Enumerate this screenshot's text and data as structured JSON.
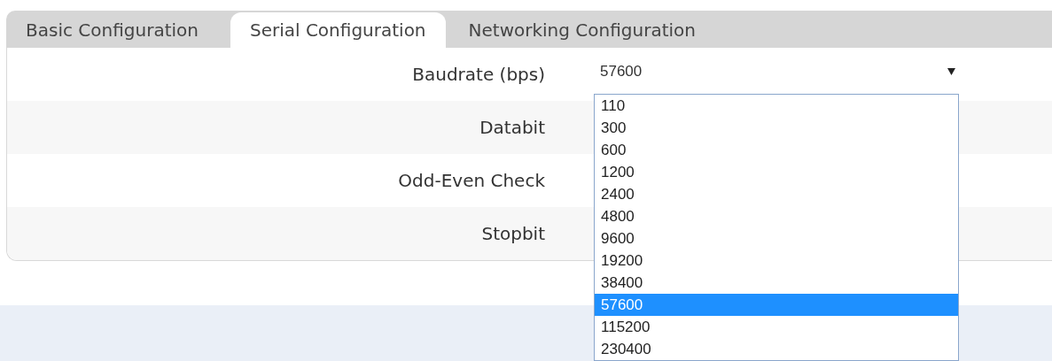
{
  "tabs": [
    {
      "label": "Basic Configuration",
      "selected": false
    },
    {
      "label": "Serial Configuration",
      "selected": true
    },
    {
      "label": "Networking Configuration",
      "selected": false
    }
  ],
  "fields": [
    {
      "label": "Baudrate (bps)",
      "value": "57600"
    },
    {
      "label": "Databit"
    },
    {
      "label": "Odd-Even Check"
    },
    {
      "label": "Stopbit"
    }
  ],
  "dropdown": {
    "open": true,
    "options": [
      {
        "label": "110",
        "selected": false
      },
      {
        "label": "300",
        "selected": false
      },
      {
        "label": "600",
        "selected": false
      },
      {
        "label": "1200",
        "selected": false
      },
      {
        "label": "2400",
        "selected": false
      },
      {
        "label": "4800",
        "selected": false
      },
      {
        "label": "9600",
        "selected": false
      },
      {
        "label": "19200",
        "selected": false
      },
      {
        "label": "38400",
        "selected": false
      },
      {
        "label": "57600",
        "selected": true
      },
      {
        "label": "115200",
        "selected": false
      },
      {
        "label": "230400",
        "selected": false
      }
    ]
  }
}
